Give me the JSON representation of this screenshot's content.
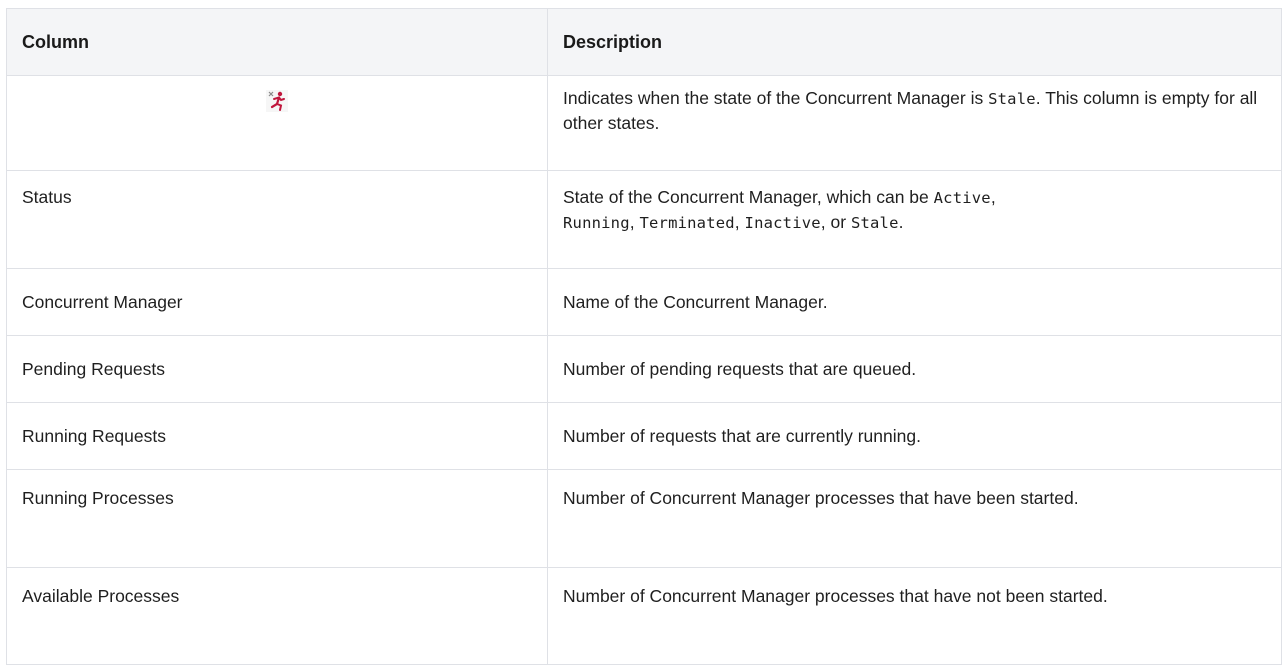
{
  "table": {
    "headers": {
      "column": "Column",
      "description": "Description"
    },
    "rows": {
      "stale": {
        "column_icon": "stale-running-figure-icon",
        "desc_pre": "Indicates when the state of the Concurrent Manager is ",
        "desc_code": "Stale",
        "desc_post": ". This column is empty for all other states."
      },
      "status": {
        "column": "Status",
        "desc_pre": "State of the Concurrent Manager, which can be ",
        "code_active": "Active",
        "sep1": ", ",
        "code_running": "Running",
        "sep2": ", ",
        "code_terminated": "Terminated",
        "sep3": ", ",
        "code_inactive": "Inactive",
        "sep4": ", or ",
        "code_stale": "Stale",
        "desc_post": "."
      },
      "concurrent_manager": {
        "column": "Concurrent Manager",
        "description": "Name of the Concurrent Manager."
      },
      "pending_requests": {
        "column": "Pending Requests",
        "description": "Number of pending requests that are queued."
      },
      "running_requests": {
        "column": "Running Requests",
        "description": "Number of requests that are currently running."
      },
      "running_processes": {
        "column": "Running Processes",
        "description": "Number of Concurrent Manager processes that have been started."
      },
      "available_processes": {
        "column": "Available Processes",
        "description": "Number of Concurrent Manager processes that have not been started."
      }
    }
  },
  "colors": {
    "header_bg": "#f4f5f7",
    "border": "#dfe1e6",
    "icon_red": "#c0163c"
  }
}
